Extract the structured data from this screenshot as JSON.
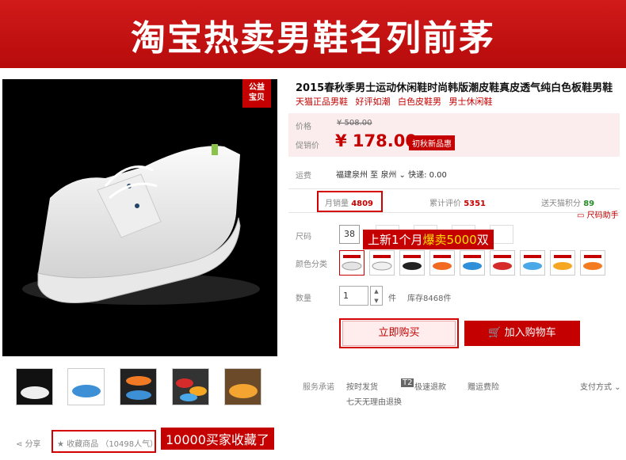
{
  "banner": {
    "title": "淘宝热卖男鞋名列前茅"
  },
  "charity": {
    "line1": "公益",
    "line2": "宝贝"
  },
  "product": {
    "title": "2015春秋季男士运动休闲鞋时尚韩版潮皮鞋真皮透气纯白色板鞋男鞋",
    "tags": [
      "天猫正品男鞋",
      "好评如潮",
      "白色皮鞋男",
      "男士休闲鞋"
    ]
  },
  "price": {
    "label": "价格",
    "original": "¥ 508.00",
    "promo_label": "促销价",
    "current": "¥ 178.00",
    "badge": "初秋新品惠"
  },
  "shipping": {
    "label": "运费",
    "text": "福建泉州 至 泉州 ⌄ 快递: 0.00"
  },
  "stats": {
    "monthly_sales_label": "月销量",
    "monthly_sales": "4809",
    "reviews_label": "累计评价",
    "reviews": "5351",
    "points_label": "送天猫积分",
    "points": "89"
  },
  "size_helper": "尺码助手",
  "size": {
    "label": "尺码",
    "selected": "38"
  },
  "color_label": "颜色分类",
  "quantity": {
    "label": "数量",
    "value": "1",
    "unit": "件",
    "stock": "库存8468件"
  },
  "buttons": {
    "buy_now": "立即购买",
    "add_cart": "加入购物车"
  },
  "service": {
    "label": "服务承诺",
    "items": [
      "按时发货",
      "极速退款",
      "赠运费险",
      "七天无理由退换"
    ],
    "pay_label": "支付方式"
  },
  "bottom": {
    "share": "分享",
    "favorite": "★ 收藏商品 （10498人气）"
  },
  "callouts": {
    "sales_prefix": "上新1个月",
    "sales_highlight": "爆卖5000",
    "sales_suffix": "双",
    "fav": "10000买家收藏了"
  },
  "colors": {
    "brand_red": "#c40000",
    "banner_red": "#d11a1a"
  }
}
